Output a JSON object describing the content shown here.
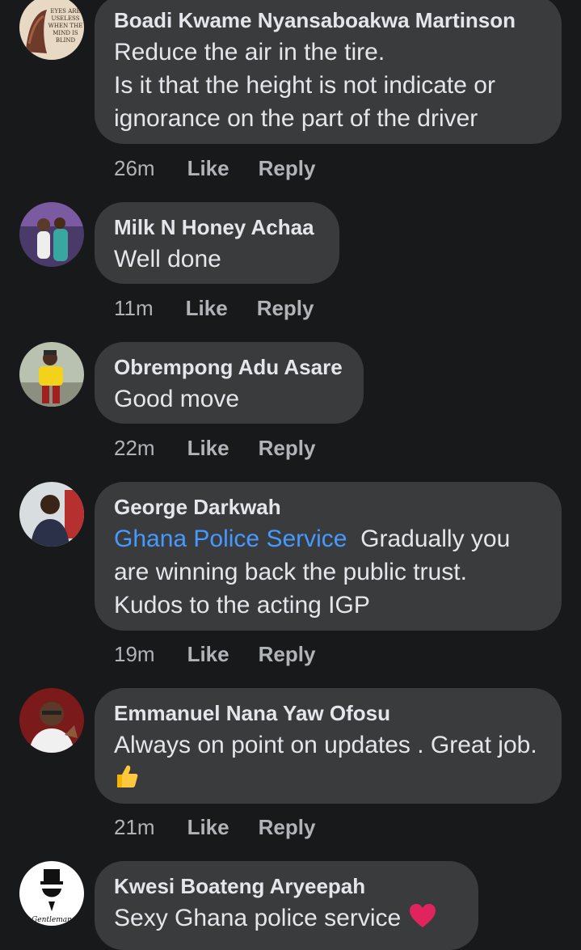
{
  "comments": [
    {
      "author": "Boadi Kwame Nyansaboakwa Martinson",
      "text": "Reduce the air in the tire.\nIs it that the height is not indicate or ignorance on the part of the driver",
      "time": "26m",
      "like": "Like",
      "reply": "Reply",
      "avatar_text": "EYES ARE USELESS WHEN THE MIND IS BLIND"
    },
    {
      "author": "Milk N Honey Achaa",
      "text": "Well done",
      "time": "11m",
      "like": "Like",
      "reply": "Reply"
    },
    {
      "author": "Obrempong Adu Asare",
      "text": "Good move",
      "time": "22m",
      "like": "Like",
      "reply": "Reply"
    },
    {
      "author": "George Darkwah",
      "mention": "Ghana Police Service",
      "text": "Gradually you are winning back the public trust. Kudos to the acting IGP",
      "time": "19m",
      "like": "Like",
      "reply": "Reply"
    },
    {
      "author": "Emmanuel Nana Yaw Ofosu",
      "text": "Always on point on updates . Great job.",
      "emoji": "thumbs-up-emoji",
      "time": "21m",
      "like": "Like",
      "reply": "Reply"
    },
    {
      "author": "Kwesi Boateng Aryeepah",
      "text": "Sexy Ghana police service",
      "emoji": "red-heart-emoji",
      "avatar_text": "Gentleman"
    }
  ],
  "colors": {
    "background": "#18191a",
    "bubble": "#3a3b3c",
    "mention": "#4599ff",
    "meta": "#b0b3b8"
  }
}
